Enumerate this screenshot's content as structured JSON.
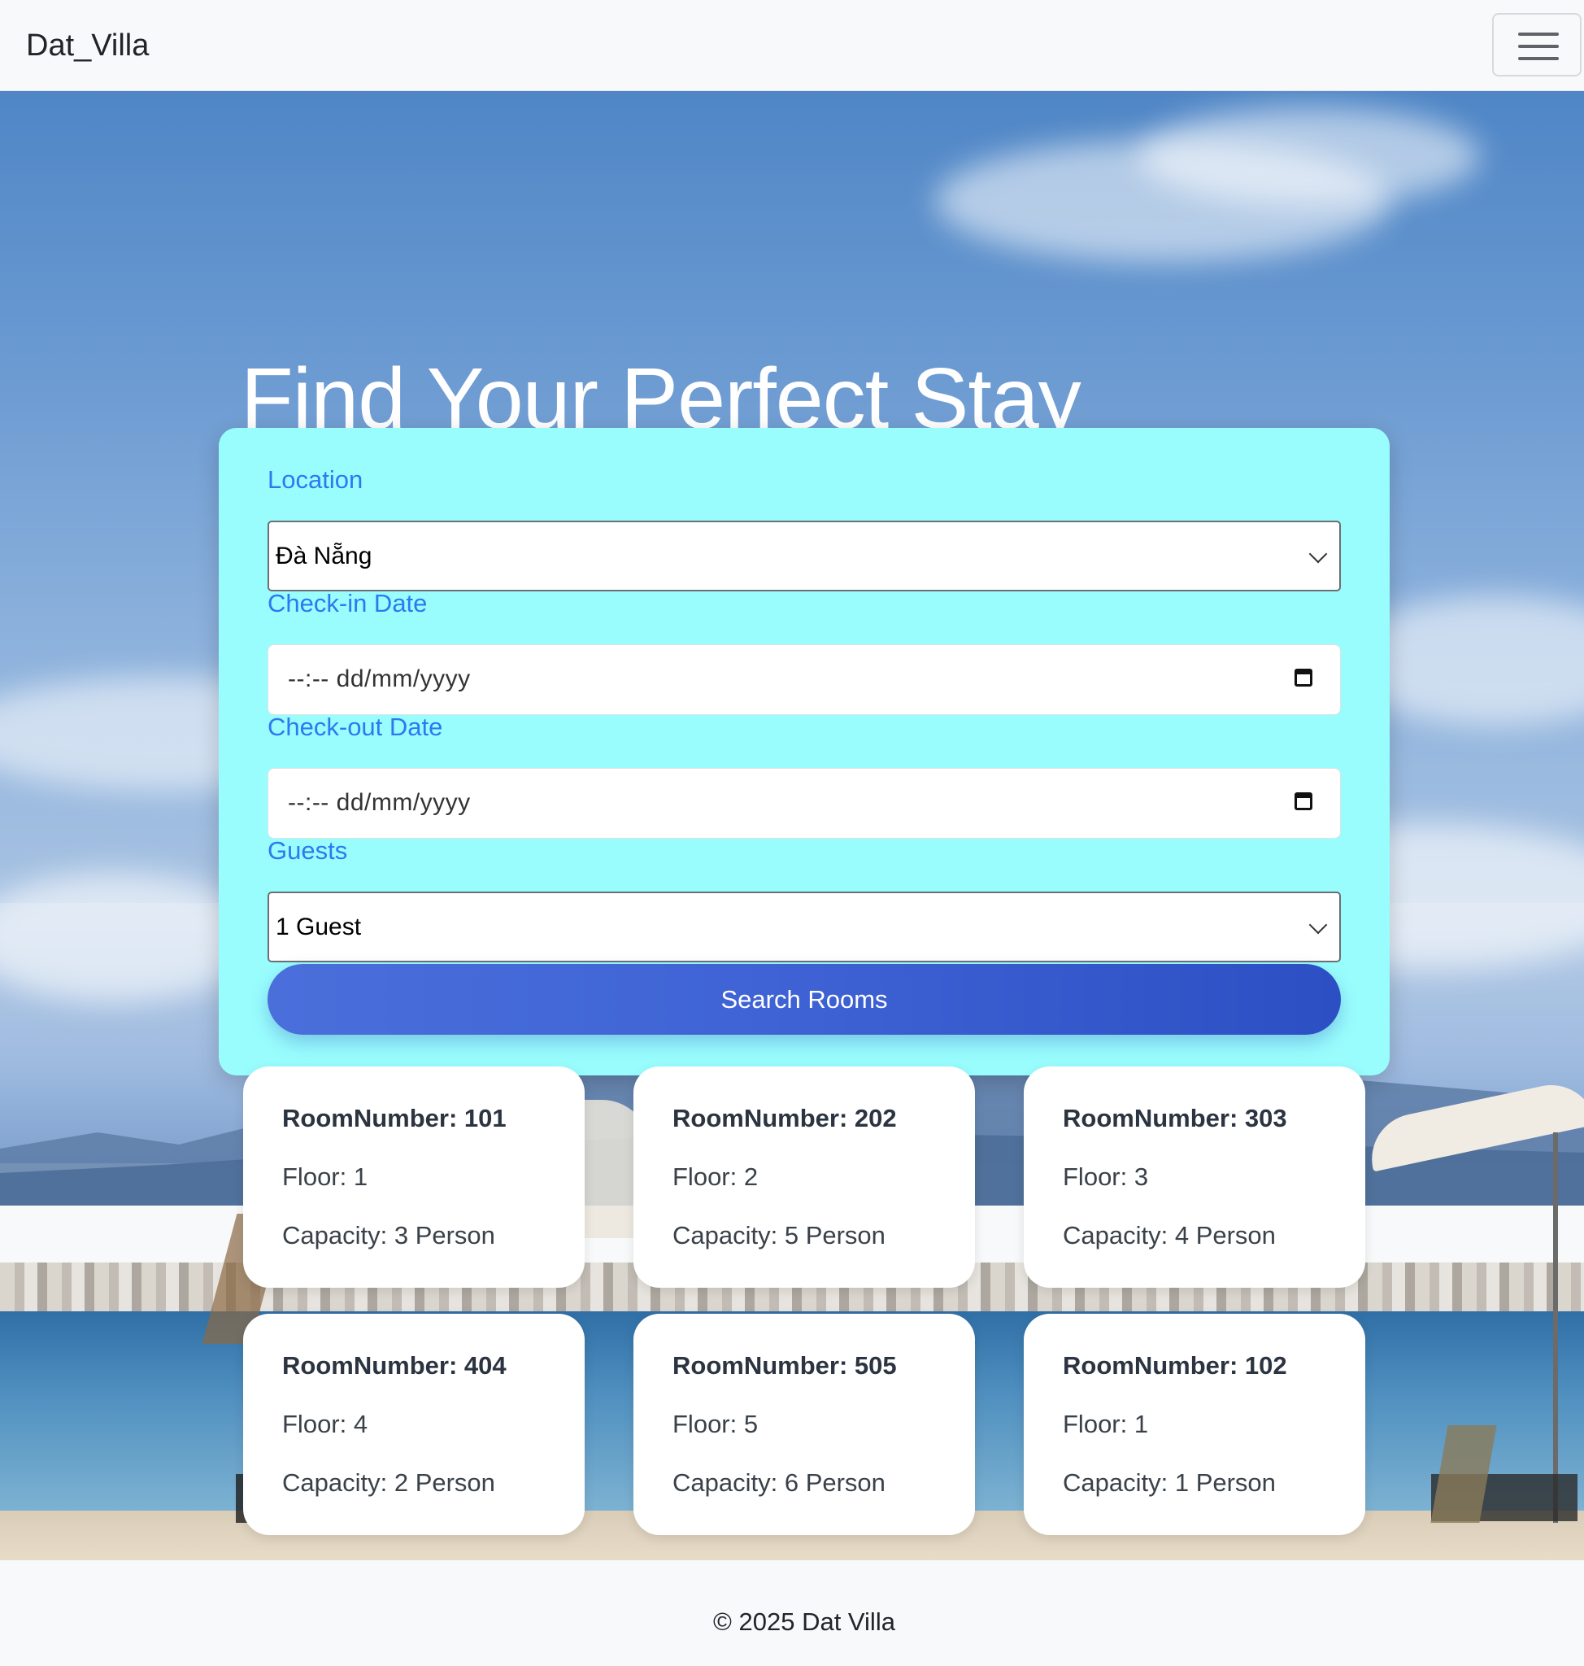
{
  "navbar": {
    "brand": "Dat_Villa",
    "menu_icon": "hamburger-menu-icon"
  },
  "hero": {
    "title": "Find Your Perfect Stay"
  },
  "search": {
    "location_label": "Location",
    "location_value": "Đà Nẵng",
    "checkin_label": "Check-in Date",
    "checkin_value": "--:-- dd/mm/yyyy",
    "checkout_label": "Check-out Date",
    "checkout_value": "--:-- dd/mm/yyyy",
    "guests_label": "Guests",
    "guests_value": "1 Guest",
    "submit_label": "Search Rooms",
    "calendar_icon": "calendar-icon",
    "chevron_icon": "chevron-down-icon"
  },
  "rooms": [
    {
      "number": "RoomNumber: 101",
      "floor": "Floor: 1",
      "capacity": "Capacity: 3 Person"
    },
    {
      "number": "RoomNumber: 202",
      "floor": "Floor: 2",
      "capacity": "Capacity: 5 Person"
    },
    {
      "number": "RoomNumber: 303",
      "floor": "Floor: 3",
      "capacity": "Capacity: 4 Person"
    },
    {
      "number": "RoomNumber: 404",
      "floor": "Floor: 4",
      "capacity": "Capacity: 2 Person"
    },
    {
      "number": "RoomNumber: 505",
      "floor": "Floor: 5",
      "capacity": "Capacity: 6 Person"
    },
    {
      "number": "RoomNumber: 102",
      "floor": "Floor: 1",
      "capacity": "Capacity: 1 Person"
    }
  ],
  "footer": {
    "text": "© 2025 Dat Villa"
  },
  "colors": {
    "search_card_bg": "#99fdfd",
    "label_blue": "#2e78f0",
    "button_blue": "#3e62d4"
  }
}
